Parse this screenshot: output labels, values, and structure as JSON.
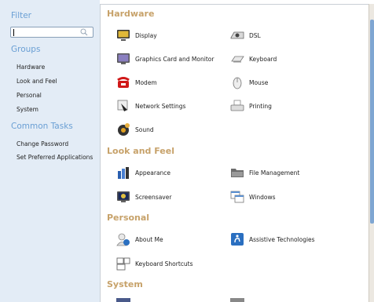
{
  "sidebar": {
    "filter_title": "Filter",
    "search": {
      "value": "",
      "placeholder": ""
    },
    "groups_title": "Groups",
    "groups": [
      "Hardware",
      "Look and Feel",
      "Personal",
      "System"
    ],
    "tasks_title": "Common Tasks",
    "tasks": [
      "Change Password",
      "Set Preferred Applications"
    ]
  },
  "sections": {
    "hardware": {
      "title": "Hardware",
      "items": [
        "Display",
        "DSL",
        "Graphics Card and Monitor",
        "Keyboard",
        "Modem",
        "Mouse",
        "Network Settings",
        "Printing",
        "Sound"
      ]
    },
    "look": {
      "title": "Look and Feel",
      "items": [
        "Appearance",
        "File Management",
        "Screensaver",
        "Windows"
      ]
    },
    "personal": {
      "title": "Personal",
      "items": [
        "About Me",
        "Assistive Technologies",
        "Keyboard Shortcuts"
      ]
    },
    "system": {
      "title": "System"
    }
  },
  "colors": {
    "sidebar_bg": "#e3ecf6",
    "sidebar_title": "#6a9fd4",
    "section_title": "#c7a26a",
    "scroll_thumb": "#7fa6d2"
  }
}
